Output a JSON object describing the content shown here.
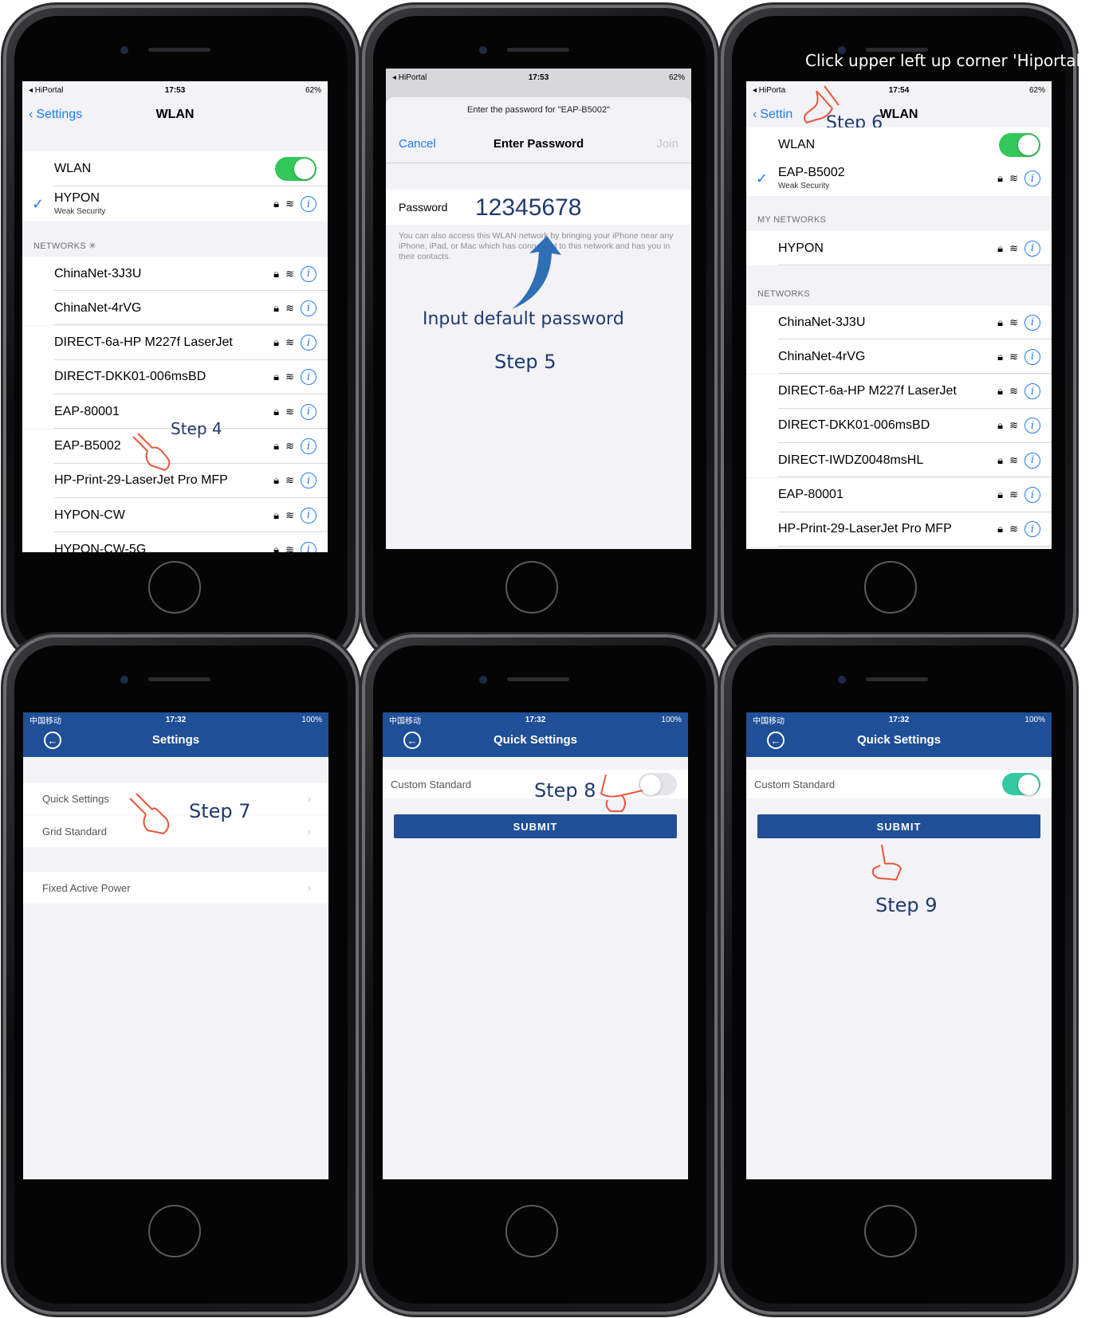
{
  "p1": {
    "status": {
      "carrier": "◂ HiPortal",
      "time": "17:53",
      "battery": "62%"
    },
    "nav": {
      "back": "Settings",
      "title": "WLAN"
    },
    "wlan_label": "WLAN",
    "connected": {
      "name": "HYPON",
      "sub": "Weak Security"
    },
    "networks_header": "NETWORKS",
    "networks": [
      "ChinaNet-3J3U",
      "ChinaNet-4rVG",
      "DIRECT-6a-HP M227f LaserJet",
      "DIRECT-DKK01-006msBD",
      "EAP-80001",
      "EAP-B5002",
      "HP-Print-29-LaserJet Pro MFP",
      "HYPON-CW",
      "HYPON-CW-5G"
    ],
    "step": "Step 4"
  },
  "p2": {
    "status": {
      "carrier": "◂ HiPortal",
      "time": "17:53",
      "battery": "62%"
    },
    "prompt": "Enter the password for \"EAP-B5002\"",
    "cancel": "Cancel",
    "title": "Enter Password",
    "join": "Join",
    "password_label": "Password",
    "password_value": "12345678",
    "help": "You can also access this WLAN network by bringing your iPhone near any iPhone, iPad, or Mac which has connected to this network and has you in their contacts.",
    "annotation": "Input default password",
    "step": "Step 5"
  },
  "p3": {
    "caption": "Click upper left up corner 'Hiportal'",
    "status": {
      "carrier": "◂ HiPorta",
      "time": "17:54",
      "battery": "62%"
    },
    "nav": {
      "back": "Settin",
      "title": "WLAN"
    },
    "step": "Step 6",
    "wlan_label": "WLAN",
    "connected": {
      "name": "EAP-B5002",
      "sub": "Weak Security"
    },
    "my_networks_header": "MY NETWORKS",
    "my_networks": [
      "HYPON"
    ],
    "networks_header": "NETWORKS",
    "networks": [
      "ChinaNet-3J3U",
      "ChinaNet-4rVG",
      "DIRECT-6a-HP M227f LaserJet",
      "DIRECT-DKK01-006msBD",
      "DIRECT-IWDZ0048msHL",
      "EAP-80001",
      "HP-Print-29-LaserJet Pro MFP"
    ]
  },
  "p4": {
    "status": {
      "carrier": "中国移动",
      "time": "17:32",
      "battery": "100%"
    },
    "title": "Settings",
    "rows": [
      "Quick Settings",
      "Grid Standard",
      "Fixed Active Power"
    ],
    "step": "Step 7"
  },
  "p5": {
    "status": {
      "carrier": "中国移动",
      "time": "17:32",
      "battery": "100%"
    },
    "title": "Quick Settings",
    "custom_label": "Custom Standard",
    "submit": "SUBMIT",
    "step": "Step 8"
  },
  "p6": {
    "status": {
      "carrier": "中国移动",
      "time": "17:32",
      "battery": "100%"
    },
    "title": "Quick Settings",
    "custom_label": "Custom Standard",
    "submit": "SUBMIT",
    "step": "Step 9"
  },
  "colors": {
    "ios_blue": "#1e7bf0",
    "ios_green": "#34c759",
    "app_bar": "#1f4f96",
    "annotation": "#1f3a6e",
    "hand": "#e8563a"
  }
}
